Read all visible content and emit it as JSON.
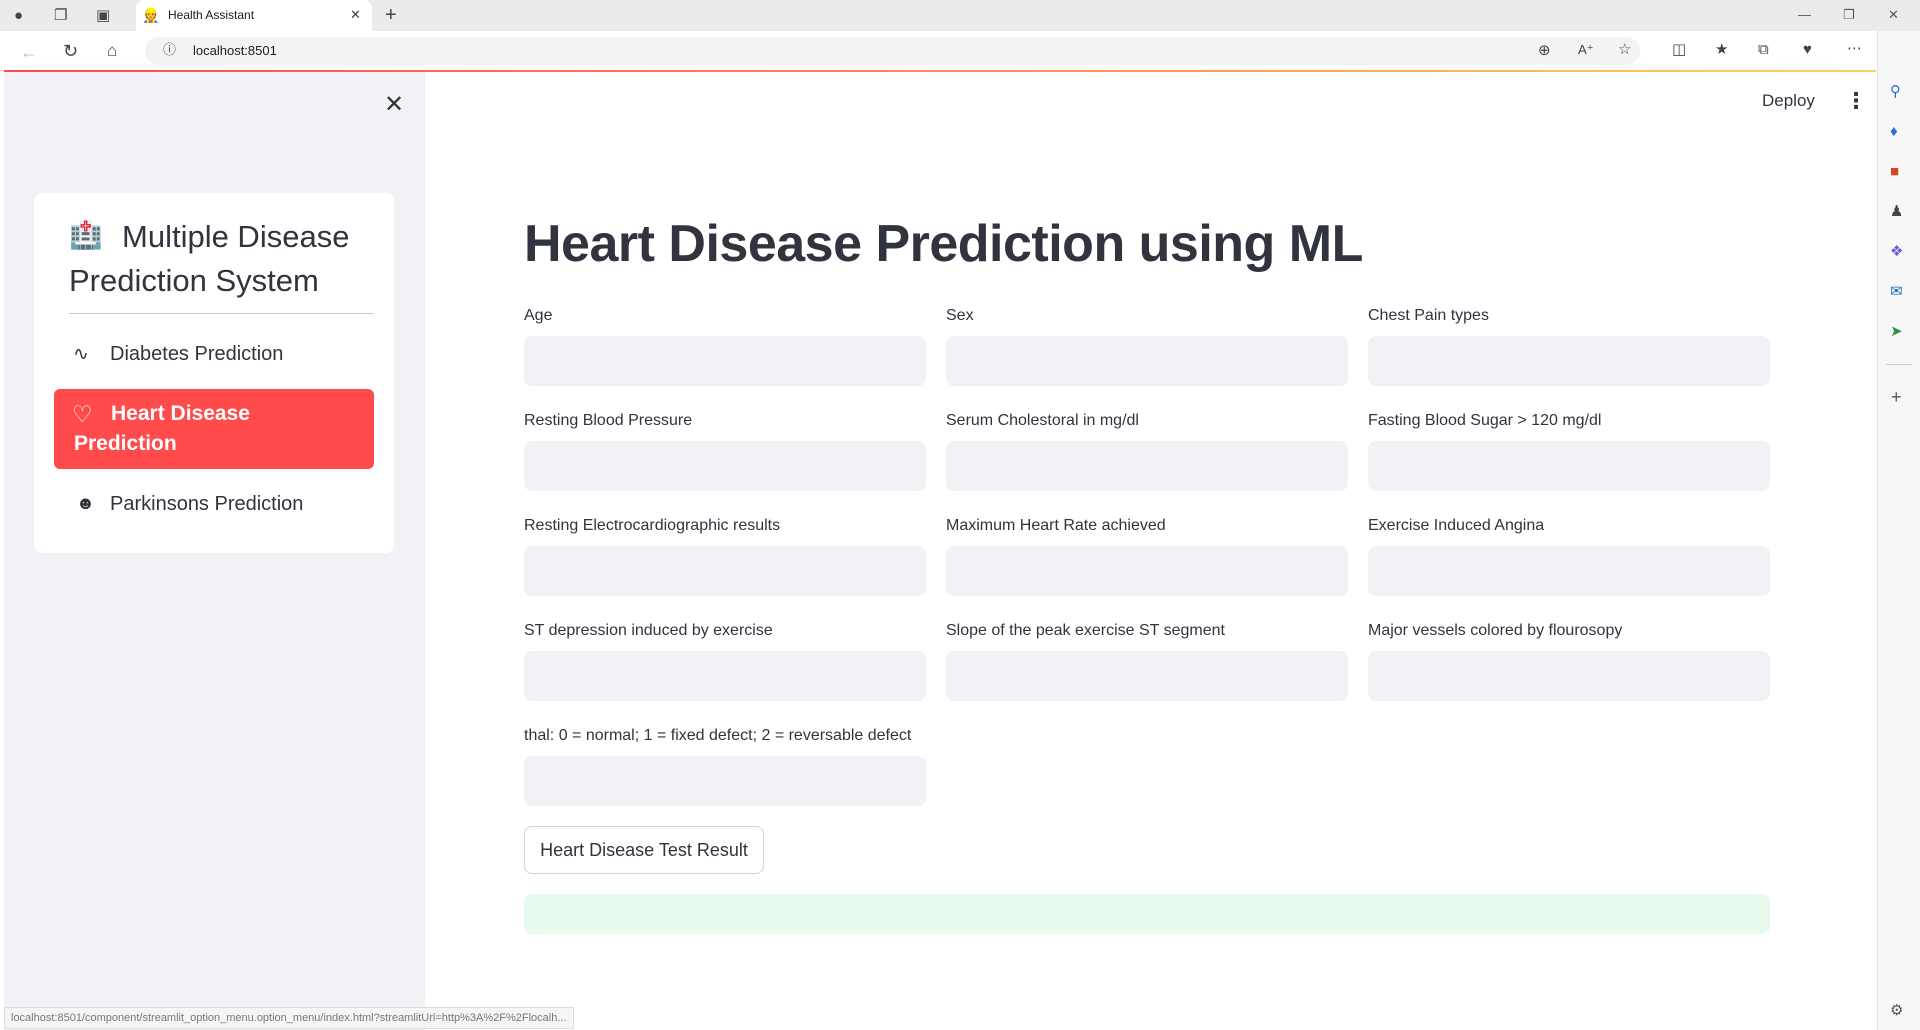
{
  "browser": {
    "tab_title": "Health Assistant",
    "url": "localhost:8501",
    "status_url": "localhost:8501/component/streamlit_option_menu.option_menu/index.html?streamlitUrl=http%3A%2F%2Flocalh..."
  },
  "header": {
    "deploy_label": "Deploy"
  },
  "sidebar": {
    "menu_title": "Multiple Disease Prediction System",
    "items": [
      {
        "label": "Diabetes Prediction",
        "icon": "activity-icon"
      },
      {
        "label": "Heart Disease Prediction",
        "icon": "heart-icon",
        "active": true
      },
      {
        "label": "Parkinsons Prediction",
        "icon": "person-icon"
      }
    ],
    "active_color": "#ff4b4b"
  },
  "main": {
    "title": "Heart Disease Prediction using ML",
    "fields": [
      {
        "label": "Age",
        "value": ""
      },
      {
        "label": "Sex",
        "value": ""
      },
      {
        "label": "Chest Pain types",
        "value": ""
      },
      {
        "label": "Resting Blood Pressure",
        "value": ""
      },
      {
        "label": "Serum Cholestoral in mg/dl",
        "value": ""
      },
      {
        "label": "Fasting Blood Sugar > 120 mg/dl",
        "value": ""
      },
      {
        "label": "Resting Electrocardiographic results",
        "value": ""
      },
      {
        "label": "Maximum Heart Rate achieved",
        "value": ""
      },
      {
        "label": "Exercise Induced Angina",
        "value": ""
      },
      {
        "label": "ST depression induced by exercise",
        "value": ""
      },
      {
        "label": "Slope of the peak exercise ST segment",
        "value": ""
      },
      {
        "label": "Major vessels colored by flourosopy",
        "value": ""
      },
      {
        "label": "thal: 0 = normal; 1 = fixed defect; 2 = reversable defect",
        "value": ""
      }
    ],
    "submit_label": "Heart Disease Test Result",
    "result_text": ""
  }
}
